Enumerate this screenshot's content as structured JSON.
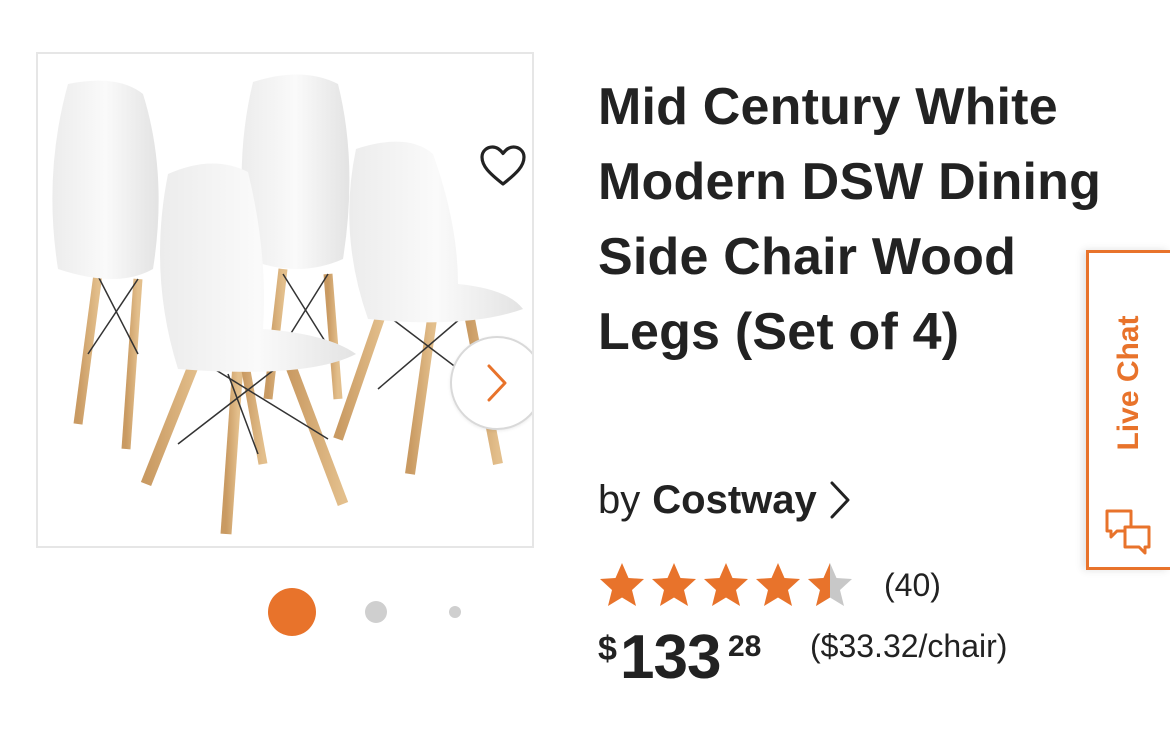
{
  "product": {
    "title": "Mid Century White Modern DSW Dining Side Chair Wood Legs (Set of 4)",
    "brand_prefix": "by",
    "brand": "Costway",
    "rating": 4.5,
    "rating_max": 5,
    "rating_count": "(40)",
    "price": {
      "currency": "$",
      "dollars": "133",
      "cents": "28",
      "unit_price": "($33.32/chair)"
    }
  },
  "gallery": {
    "image_count": 3,
    "active_index": 0
  },
  "live_chat": {
    "label": "Live Chat"
  },
  "colors": {
    "accent": "#e8732b",
    "text": "#222222",
    "star_empty": "#c8c8c8"
  },
  "icons": {
    "favorite": "heart-outline-icon",
    "next": "chevron-right-icon",
    "brand_link": "chevron-right-icon",
    "chat": "chat-bubbles-icon"
  }
}
